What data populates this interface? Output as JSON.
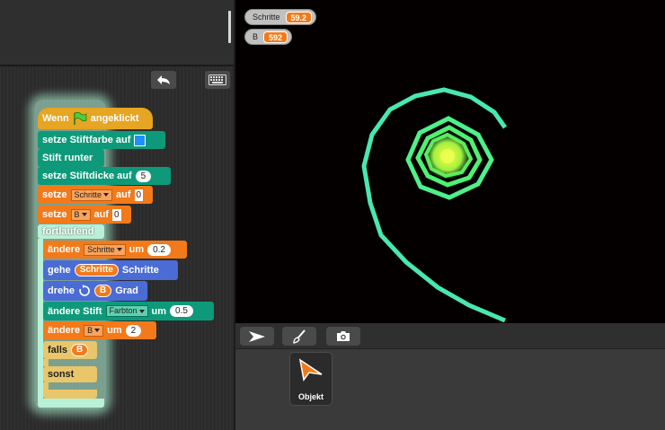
{
  "toolbar": {
    "undo_icon": "undo-icon",
    "keyboard_icon": "keyboard-icon"
  },
  "script": {
    "hat": {
      "label": "Wenn",
      "flag_icon": "green-flag-icon",
      "suffix": "angeklickt"
    },
    "set_pen_color": "setze Stiftfarbe auf",
    "pen_down": "Stift runter",
    "set_pen_size": {
      "label": "setze Stiftdicke auf",
      "value": "5"
    },
    "set_var1": {
      "label": "setze",
      "var": "Schritte",
      "to": "auf",
      "value": "0"
    },
    "set_var2": {
      "label": "setze",
      "var": "B",
      "to": "auf",
      "value": "0"
    },
    "forever": "fortlaufend",
    "change_var1": {
      "label": "ändere",
      "var": "Schritte",
      "by": "um",
      "value": "0.2"
    },
    "move": {
      "label": "gehe",
      "reporter": "Schritte",
      "suffix": "Schritte"
    },
    "turn": {
      "label": "drehe",
      "reporter": "B",
      "suffix": "Grad"
    },
    "change_pen": {
      "label": "ändere Stift",
      "param": "Farbton",
      "by": "um",
      "value": "0.5"
    },
    "change_var2": {
      "label": "ändere",
      "var": "B",
      "by": "um",
      "value": "2"
    },
    "if_else": {
      "if_label": "falls",
      "condition": "B",
      "else_label": "sonst"
    }
  },
  "watchers": [
    {
      "name": "Schritte",
      "value": "59.2"
    },
    {
      "name": "B",
      "value": "592"
    }
  ],
  "stage_controls": {
    "turtle_icon": "arrow-turtle-icon",
    "paint_icon": "paintbrush-icon",
    "camera_icon": "camera-icon"
  },
  "corral": {
    "sprite_label": "Objekt"
  },
  "colors": {
    "pen_color_swatch": "#1e90ff",
    "drawing_outer": "#48e8b0",
    "drawing_mid": "#50f070",
    "drawing_core": "#d8ff40"
  }
}
